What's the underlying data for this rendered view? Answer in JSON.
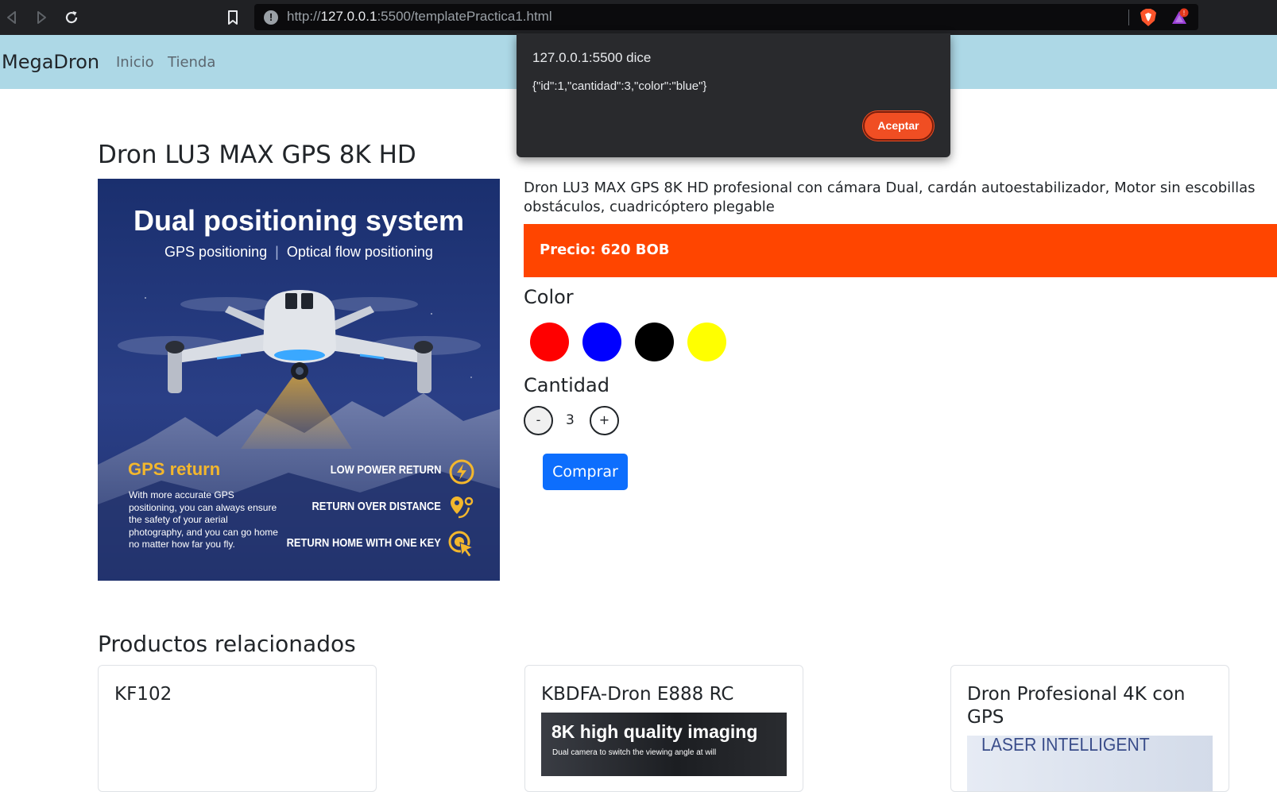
{
  "browser": {
    "url_prefix": "http://",
    "url_host": "127.0.0.1",
    "url_rest": ":5500/templatePractica1.html",
    "rewards_badge": "!"
  },
  "navbar": {
    "brand": "MegaDron",
    "links": [
      "Inicio",
      "Tienda"
    ],
    "background": "#add8e6"
  },
  "alert": {
    "title": "127.0.0.1:5500 dice",
    "message": "{\"id\":1,\"cantidad\":3,\"color\":\"blue\"}",
    "accept_label": "Aceptar",
    "accent": "#f04e23"
  },
  "product": {
    "title": "Dron LU3 MAX GPS 8K HD",
    "description": "Dron LU3 MAX GPS 8K HD profesional con cámara Dual, cardán autoestabilizador, Motor sin escobillas obstáculos, cuadricóptero plegable",
    "price": "Precio: 620 BOB",
    "price_color": "#ff4500",
    "color_label": "Color",
    "colors": [
      "#ff0000",
      "#0000ff",
      "#000000",
      "#ffff00"
    ],
    "quantity_label": "Cantidad",
    "minus_label": "-",
    "plus_label": "+",
    "quantity": "3",
    "buy_label": "Comprar",
    "buy_color": "#0d6efd",
    "image": {
      "headline": "Dual positioning system",
      "sub_left": "GPS positioning",
      "sub_sep": "|",
      "sub_right": "Optical flow positioning",
      "gps_title": "GPS return",
      "gps_text": "With more accurate GPS positioning, you can always ensure the safety of your aerial photography, and you can go home no matter how far you fly.",
      "features": [
        "LOW POWER RETURN",
        "RETURN OVER DISTANCE",
        "RETURN HOME WITH ONE KEY"
      ]
    }
  },
  "related": {
    "title": "Productos relacionados",
    "cards": [
      {
        "title": "KF102"
      },
      {
        "title": "KBDFA-Dron E888 RC",
        "img_head": "8K high quality imaging",
        "img_sub": "Dual camera to switch the viewing angle at will"
      },
      {
        "title": "Dron Profesional 4K con GPS",
        "img_head": "LASER INTELLIGENT"
      }
    ]
  }
}
